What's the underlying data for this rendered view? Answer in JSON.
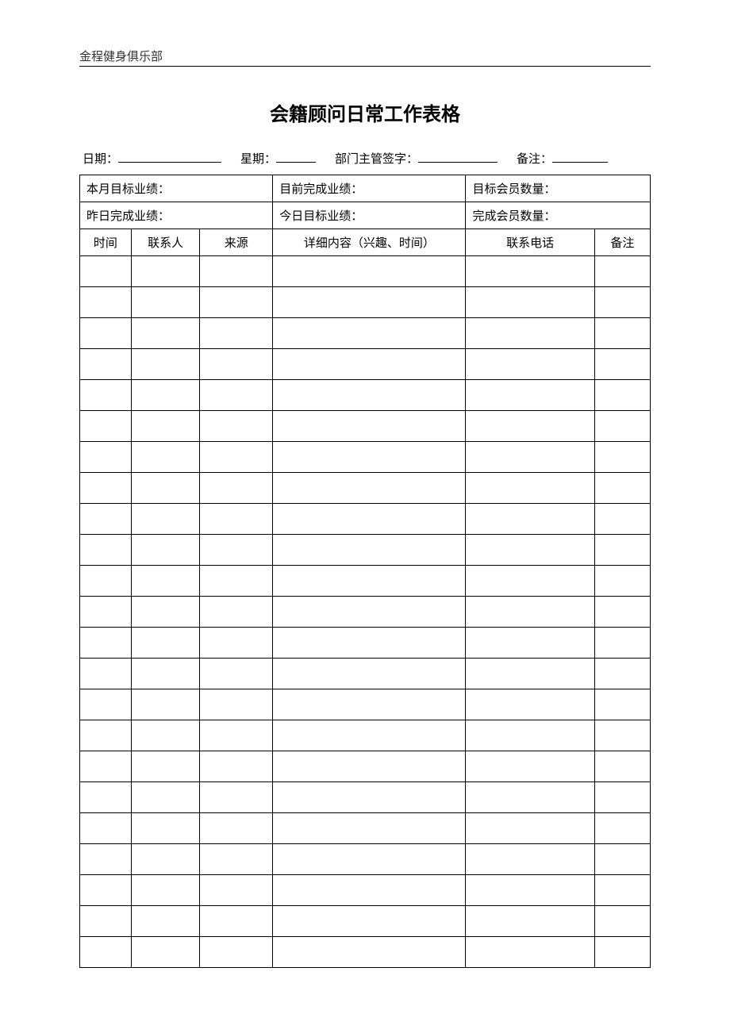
{
  "header": {
    "org_name": "金程健身俱乐部"
  },
  "title": "会籍顾问日常工作表格",
  "meta": {
    "date_label": "日期：",
    "weekday_label": "星期：",
    "signoff_label": "部门主管签字：",
    "note_label": "备注："
  },
  "summary": {
    "row1": {
      "a": "本月目标业绩：",
      "b": "目前完成业绩：",
      "c": "目标会员数量："
    },
    "row2": {
      "a": "昨日完成业绩：",
      "b": "今日目标业绩：",
      "c": "完成会员数量："
    }
  },
  "columns": {
    "time": "时间",
    "contact": "联系人",
    "source": "来源",
    "details": "详细内容（兴趣、时间）",
    "phone": "联系电话",
    "remark": "备注"
  },
  "row_count": 23
}
